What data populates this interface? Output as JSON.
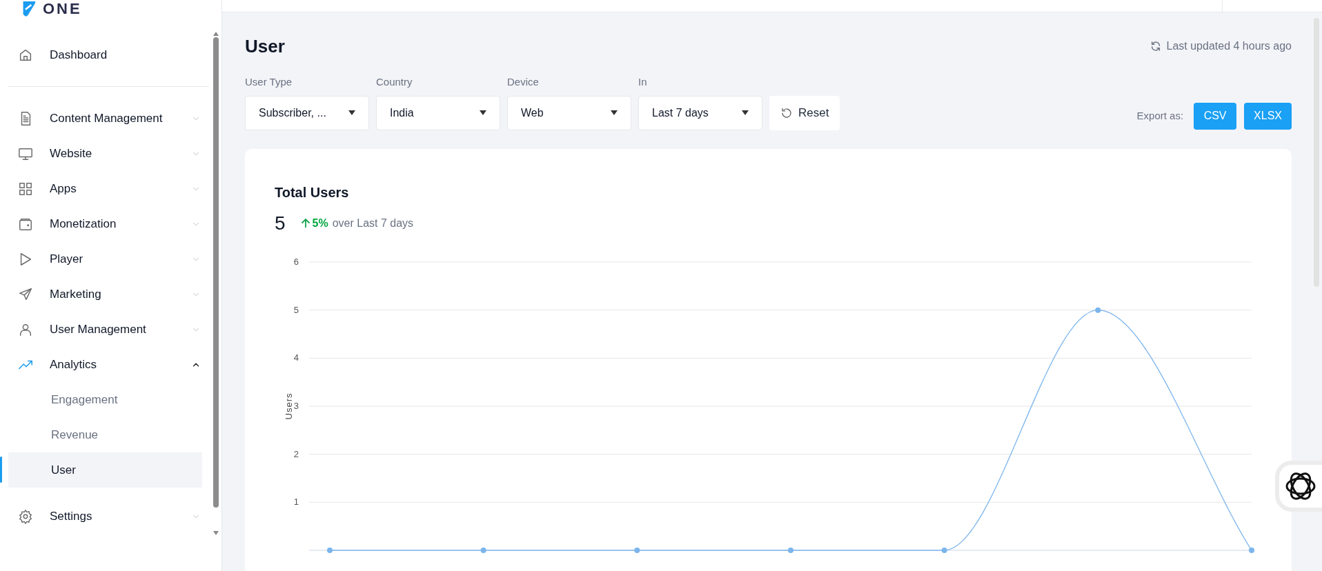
{
  "logo": {
    "text": "ONE"
  },
  "sidebar": {
    "sections": [
      {
        "items": [
          {
            "label": "Dashboard",
            "kind": "link"
          }
        ]
      },
      {
        "items": [
          {
            "label": "Content Management",
            "kind": "group",
            "expanded": false
          },
          {
            "label": "Website",
            "kind": "group",
            "expanded": false
          },
          {
            "label": "Apps",
            "kind": "group",
            "expanded": false
          },
          {
            "label": "Monetization",
            "kind": "group",
            "expanded": false
          },
          {
            "label": "Player",
            "kind": "group",
            "expanded": false
          },
          {
            "label": "Marketing",
            "kind": "group",
            "expanded": false
          },
          {
            "label": "User Management",
            "kind": "group",
            "expanded": false
          },
          {
            "label": "Analytics",
            "kind": "group",
            "expanded": true,
            "children": [
              {
                "label": "Engagement",
                "selected": false
              },
              {
                "label": "Revenue",
                "selected": false
              },
              {
                "label": "User",
                "selected": true
              }
            ]
          }
        ]
      },
      {
        "items": [
          {
            "label": "Settings",
            "kind": "group",
            "expanded": false
          }
        ]
      }
    ]
  },
  "page": {
    "title": "User",
    "last_updated": "Last updated 4 hours ago"
  },
  "filters": [
    {
      "label": "User Type",
      "value": "Subscriber, ..."
    },
    {
      "label": "Country",
      "value": "India"
    },
    {
      "label": "Device",
      "value": "Web"
    },
    {
      "label": "In",
      "value": "Last 7 days"
    }
  ],
  "reset": {
    "label": "Reset"
  },
  "export": {
    "label": "Export as:",
    "buttons": [
      "CSV",
      "XLSX"
    ]
  },
  "card": {
    "title": "Total Users",
    "total": "5",
    "change": "5%",
    "change_period": "over Last 7 days",
    "chart_data": {
      "type": "line",
      "ylabel": "Users",
      "ylim": [
        0,
        6
      ],
      "yticks": [
        1,
        2,
        3,
        4,
        5,
        6
      ],
      "grid": true,
      "series": [
        {
          "color": "#7cb5ec",
          "marker": true,
          "values": [
            0,
            0,
            0,
            0,
            0,
            5,
            0
          ]
        }
      ]
    }
  }
}
